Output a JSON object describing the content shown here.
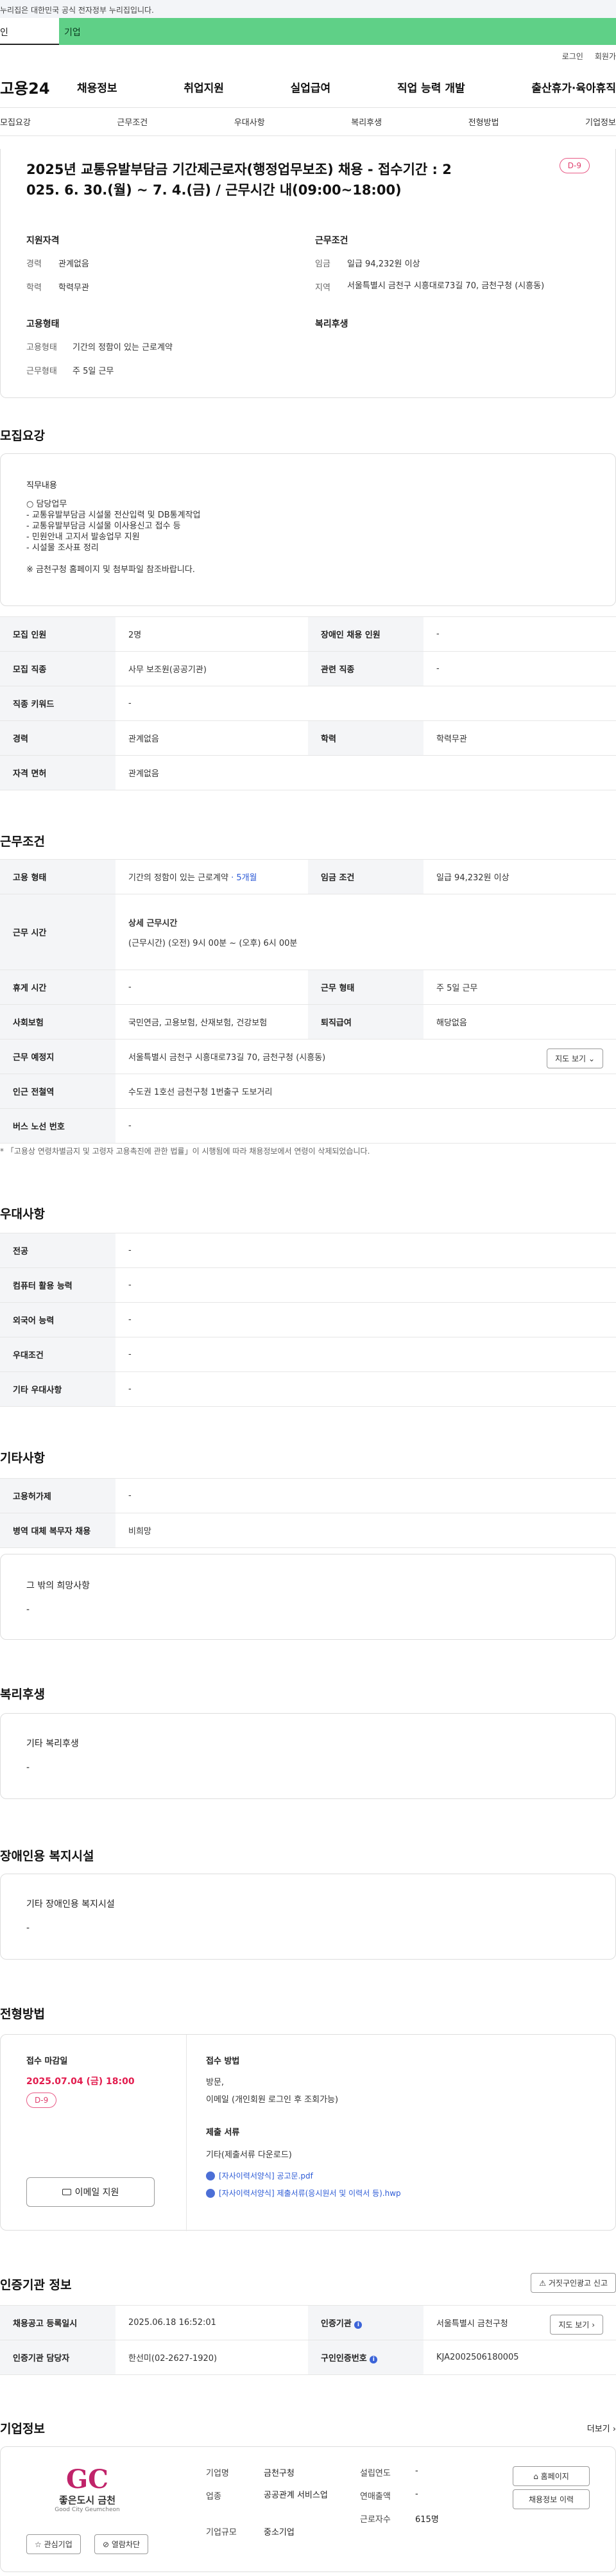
{
  "gov_bar": "누리집은 대한민국 공식 전자정부 누리집입니다.",
  "type_tabs": {
    "personal": "인",
    "company": "기업"
  },
  "utility": {
    "login": "로그인",
    "join": "회원가"
  },
  "gnb": {
    "logo": "고용24",
    "menus": [
      "채용정보",
      "취업지원",
      "실업급여",
      "직업 능력 개발",
      "출산휴가·육아휴직"
    ]
  },
  "tabs": [
    "모집요강",
    "근무조건",
    "우대사항",
    "복리후생",
    "전형방법",
    "기업정보"
  ],
  "summary": {
    "title": "2025년 교통유발부담금 기간제근로자(행정업무보조) 채용 - 접수기간 : 2025. 6. 30.(월) ~ 7. 4.(금) / 근무시간 내(09:00~18:00)",
    "title_line1": "2025년 교통유발부담금 기간제근로자(행정업무보조) 채용 - 접수기간 : 2",
    "title_line2": "025. 6. 30.(월) ~ 7. 4.(금) / 근무시간 내(09:00~18:00)",
    "dday": "D-9",
    "qual_title": "지원자격",
    "qual": [
      {
        "k": "경력",
        "v": "관계없음"
      },
      {
        "k": "학력",
        "v": "학력무관"
      }
    ],
    "cond_title": "근무조건",
    "cond": [
      {
        "k": "임금",
        "v": "일급 94,232원 이상"
      },
      {
        "k": "지역",
        "v": "서울특별시 금천구 시흥대로73길 70, 금천구청 (시흥동)"
      }
    ],
    "emp_title": "고용형태",
    "emp": [
      {
        "k": "고용형태",
        "v": "기간의 정함이 있는 근로계약"
      },
      {
        "k": "근무형태",
        "v": "주 5일 근무"
      }
    ],
    "welfare_title": "복리후생"
  },
  "recruit": {
    "section": "모집요강",
    "duty_title": "직무내용",
    "duty_lines": [
      "○ 담당업무",
      "- 교통유발부담금 시설물 전산입력 및 DB통계작업",
      "- 교통유발부담금 시설물 이사용신고 접수 등",
      "- 민원안내 고지서 발송업무 지원",
      "- 시설물 조사표 정리",
      "",
      "※ 금천구청 홈페이지 및 첨부파일 참조바랍니다."
    ],
    "rows": [
      [
        "모집 인원",
        "2명",
        "장애인 채용 인원",
        "-"
      ],
      [
        "모집 직종",
        "사무 보조원(공공기관)",
        "관련 직종",
        "-"
      ],
      [
        "직종 키워드",
        "-",
        "",
        ""
      ],
      [
        "경력",
        "관계없음",
        "학력",
        "학력무관"
      ],
      [
        "자격 면허",
        "관계없음",
        "",
        ""
      ]
    ]
  },
  "work": {
    "section": "근무조건",
    "emp_type_label": "고용 형태",
    "emp_type_value": "기간의 정함이 있는 근로계약",
    "emp_type_period": "· 5개월",
    "wage_label": "임금 조건",
    "wage_value": "일급 94,232원 이상",
    "hours_label": "근무 시간",
    "hours_title": "상세 근무시간",
    "hours_value": "(근무시간) (오전) 9시 00분 ~ (오후) 6시 00분",
    "rest_label": "휴게 시간",
    "rest_value": "-",
    "form_label": "근무 형태",
    "form_value": "주 5일 근무",
    "ins_label": "사회보험",
    "ins_value": "국민연금, 고용보험, 산재보험, 건강보험",
    "sev_label": "퇴직급여",
    "sev_value": "해당없음",
    "place_label": "근무 예정지",
    "place_value": "서울특별시 금천구 시흥대로73길 70, 금천구청 (시흥동)",
    "map_btn": "지도 보기",
    "station_label": "인근 전철역",
    "station_value": "수도권 1호선 금천구청 1번출구 도보거리",
    "bus_label": "버스 노선 번호",
    "bus_value": "-",
    "notice": "* 「고용상 연령차별금지 및 고령자 고용촉진에 관한 법률」이 시행됨에 따라 채용정보에서 연령이 삭제되었습니다."
  },
  "pref": {
    "section": "우대사항",
    "rows": [
      [
        "전공",
        "-"
      ],
      [
        "컴퓨터 활용 능력",
        "-"
      ],
      [
        "외국어 능력",
        "-"
      ],
      [
        "우대조건",
        "-"
      ],
      [
        "기타 우대사항",
        "-"
      ]
    ]
  },
  "etc": {
    "section": "기타사항",
    "rows": [
      [
        "고용허가제",
        "-"
      ],
      [
        "병역 대체 복무자 채용",
        "비희망"
      ]
    ],
    "other_title": "그 밖의 희망사항",
    "other_value": "-"
  },
  "welfare": {
    "section": "복리후생",
    "title": "기타 복리후생",
    "value": "-"
  },
  "disability": {
    "section": "장애인용 복지시설",
    "title": "기타 장애인용 복지시설",
    "value": "-"
  },
  "selection": {
    "section": "전형방법",
    "deadline_title": "접수 마감일",
    "deadline": "2025.07.04 (금) 18:00",
    "dday": "D-9",
    "email_btn": "이메일 지원",
    "method_title": "접수 방법",
    "method_lines": [
      "방문,",
      "이메일 (개인회원 로그인 후 조회가능)"
    ],
    "docs_title": "제출 서류",
    "docs_value": "기타(제출서류 다운로드)",
    "files": [
      "[자사이력서양식] 공고문.pdf",
      "[자사이력서양식] 제출서류(응시원서 및 이력서 등).hwp"
    ]
  },
  "cert": {
    "section": "인증기관 정보",
    "report_btn": "거짓구인광고 신고",
    "rows": [
      {
        "k1": "채용공고 등록일시",
        "v1": "2025.06.18 16:52:01",
        "k2": "인증기관",
        "v2": "서울특별시 금천구청",
        "btn": "지도 보기"
      },
      {
        "k1": "인증기관 담당자",
        "v1": "한선미(02-2627-1920)",
        "k2": "구인인증번호",
        "v2": "KJA2002506180005"
      }
    ]
  },
  "company": {
    "section": "기업정보",
    "more": "더보기",
    "logo_text": "GC",
    "logo_sub": "좋은도시 금천",
    "logo_eng": "Good City Geumcheon",
    "fields": [
      {
        "k": "기업명",
        "v": "금천구청"
      },
      {
        "k": "업종",
        "v": "공공관계 서비스업"
      },
      {
        "k": "기업규모",
        "v": "중소기업"
      }
    ],
    "fields2": [
      {
        "k": "설립연도",
        "v": "-"
      },
      {
        "k": "연매출액",
        "v": "-"
      },
      {
        "k": "근로자수",
        "v": "615명"
      }
    ],
    "interest_btn": "관심기업",
    "block_btn": "열람차단",
    "homepage_btn": "홈페이지",
    "jobs_btn": "채용정보 이력"
  },
  "colors": {
    "brand_green": "#5fd087",
    "accent_pink": "#e03e6e",
    "link_blue": "#2d5bd6"
  }
}
